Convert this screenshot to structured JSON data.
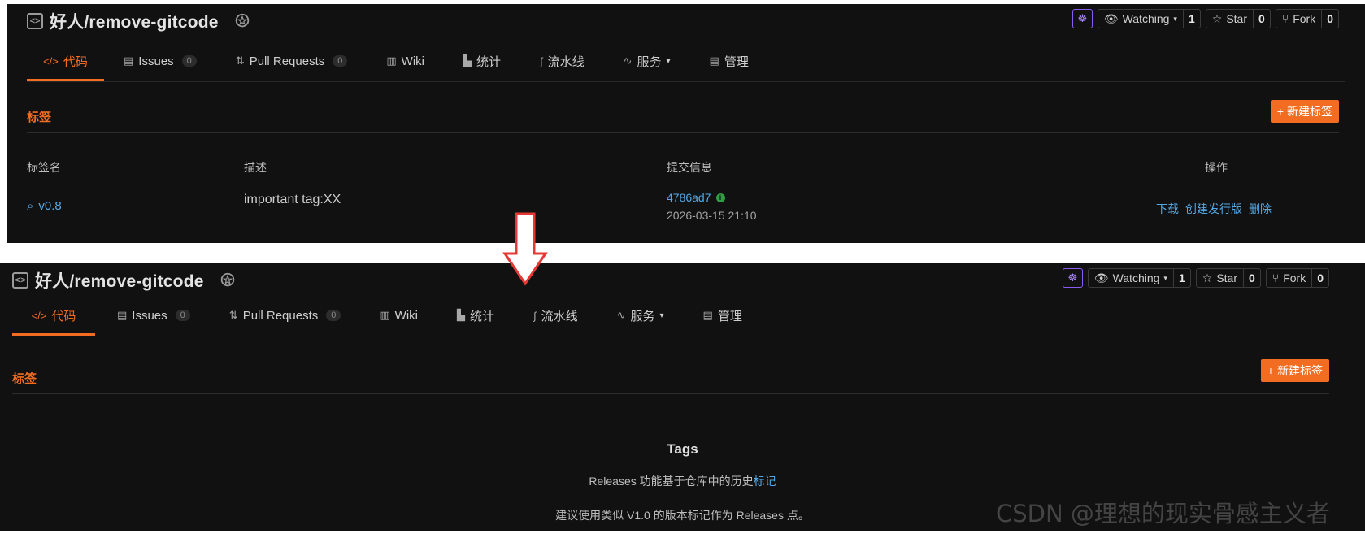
{
  "top": {
    "repo_title": "好人/remove-gitcode",
    "watching": {
      "label": "Watching",
      "count": "1"
    },
    "star": {
      "label": "Star",
      "count": "0"
    },
    "fork": {
      "label": "Fork",
      "count": "0"
    },
    "tabs": [
      {
        "label": "代码",
        "icon": "code-icon"
      },
      {
        "label": "Issues",
        "count": "0",
        "icon": "issues-icon"
      },
      {
        "label": "Pull Requests",
        "count": "0",
        "icon": "pull-request-icon"
      },
      {
        "label": "Wiki",
        "icon": "wiki-icon"
      },
      {
        "label": "统计",
        "icon": "stats-icon"
      },
      {
        "label": "流水线",
        "icon": "pipeline-icon"
      },
      {
        "label": "服务",
        "icon": "service-icon"
      },
      {
        "label": "管理",
        "icon": "manage-icon"
      }
    ],
    "section_title": "标签",
    "new_tag_button": "+ 新建标签",
    "table_headers": {
      "name": "标签名",
      "desc": "描述",
      "commit": "提交信息",
      "actions": "操作"
    },
    "row": {
      "tag": "v0.8",
      "desc": "important tag:XX",
      "commit_hash": "4786ad7",
      "commit_time": "2026-03-15 21:10",
      "action_download": "下载",
      "action_release": "创建发行版",
      "action_delete": "删除"
    }
  },
  "bottom": {
    "repo_title": "好人/remove-gitcode",
    "watching": {
      "label": "Watching",
      "count": "1"
    },
    "star": {
      "label": "Star",
      "count": "0"
    },
    "fork": {
      "label": "Fork",
      "count": "0"
    },
    "tabs": [
      {
        "label": "代码"
      },
      {
        "label": "Issues",
        "count": "0"
      },
      {
        "label": "Pull Requests",
        "count": "0"
      },
      {
        "label": "Wiki"
      },
      {
        "label": "统计"
      },
      {
        "label": "流水线"
      },
      {
        "label": "服务"
      },
      {
        "label": "管理"
      }
    ],
    "section_title": "标签",
    "new_tag_button": "+ 新建标签",
    "empty_title": "Tags",
    "empty_line1_prefix": "Releases 功能基于仓库中的历史",
    "empty_line1_link": "标记",
    "empty_line2": "建议使用类似 V1.0 的版本标记作为 Releases 点。"
  },
  "watermark": "CSDN @理想的现实骨感主义者",
  "colors": {
    "accent": "#f26d21",
    "link": "#53a9e6",
    "panel": "#111111",
    "arrow": "#e53935"
  }
}
